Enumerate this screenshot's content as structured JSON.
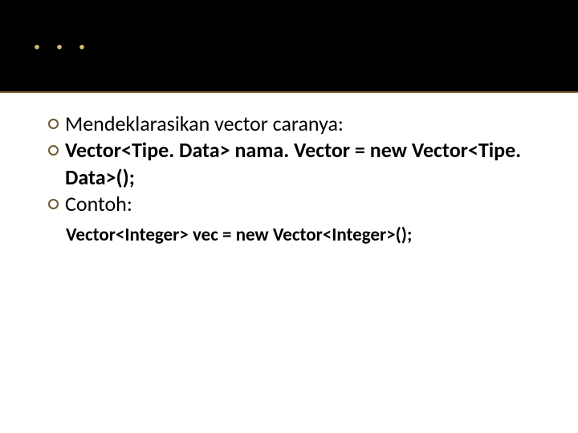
{
  "title": ". . .",
  "bullets": [
    {
      "text": "Mendeklarasikan vector caranya:",
      "bold": false
    },
    {
      "text": "Vector<Tipe. Data> nama. Vector = new Vector<Tipe. Data>();",
      "bold": true
    },
    {
      "text": "Contoh:",
      "bold": false
    }
  ],
  "subitems": [
    {
      "text": "Vector<Integer> vec = new Vector<Integer>();"
    }
  ]
}
